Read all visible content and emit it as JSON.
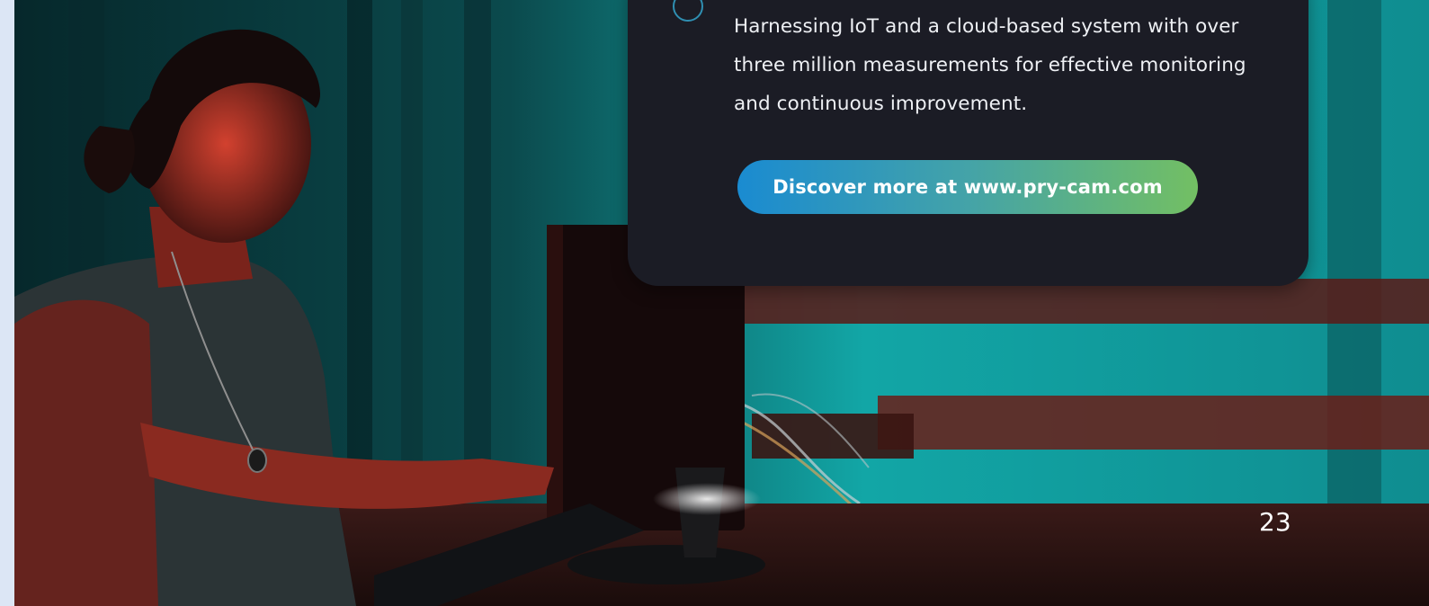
{
  "card": {
    "text": "Harnessing IoT and a cloud-based system with over three million measurements for effective monitoring and continuous improvement.",
    "button_label": "Discover more at www.pry-cam.com"
  },
  "page_number": "23",
  "colors": {
    "card_background": "#1b1c25",
    "button_gradient_start": "#1a8bd1",
    "button_gradient_end": "#73bf63",
    "bullet_ring": "#2f8fb2"
  }
}
